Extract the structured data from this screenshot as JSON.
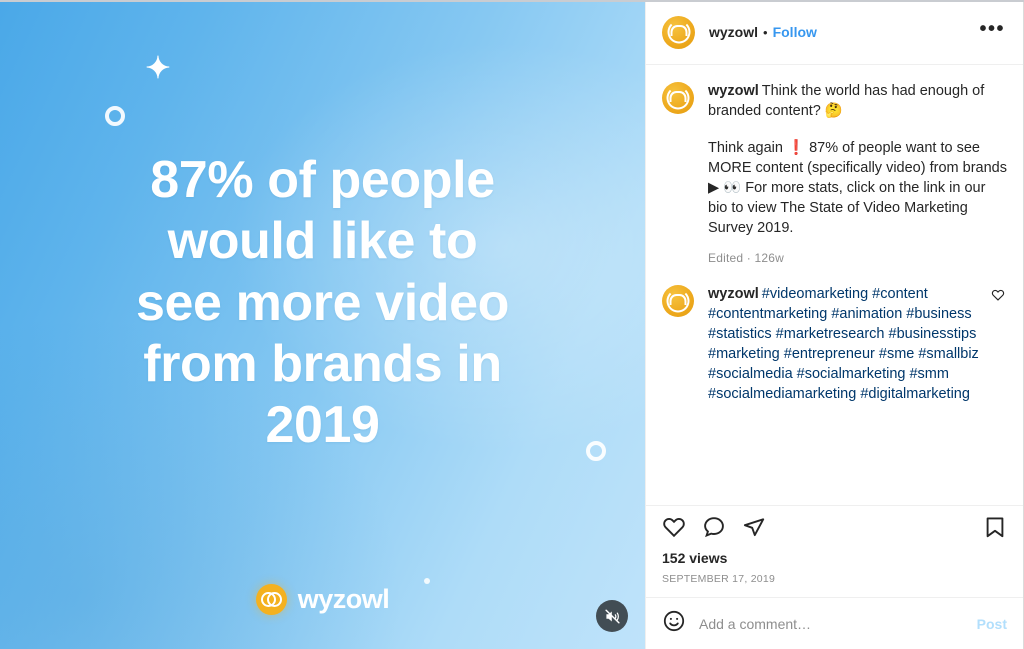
{
  "media": {
    "headline": "87% of people\nwould like to\nsee more video\nfrom brands in\n2019",
    "brand_name": "wyzowl",
    "brand_color": "#f4b11f",
    "bg_color_start": "#4aa8e8",
    "bg_color_end": "#bfe3fa",
    "sparkle_glyph": "✦",
    "mute_icon": "speaker-muted-icon"
  },
  "header": {
    "username": "wyzowl",
    "separator": "•",
    "follow_label": "Follow",
    "more_label": "•••",
    "avatar_icon": "wyzowl-avatar"
  },
  "caption": {
    "username": "wyzowl",
    "line1": "Think the world has had enough of branded content? 🤔",
    "line2": "Think again ❗ 87% of people want to see MORE content (specifically video) from brands ▶ 👀 For more stats, click on the link in our bio to view The State of Video Marketing Survey 2019.",
    "edited_label": "Edited",
    "edited_separator": "·",
    "age": "126w"
  },
  "comment": {
    "username": "wyzowl",
    "hashtags": "#videomarketing #content #contentmarketing #animation #business #statistics #marketresearch #businesstips #marketing #entrepreneur #sme #smallbiz #socialmedia #socialmarketing #smm #socialmediamarketing #digitalmarketing",
    "like_icon": "heart-icon"
  },
  "actions": {
    "like_icon": "heart-icon",
    "comment_icon": "speech-bubble-icon",
    "share_icon": "paper-plane-icon",
    "save_icon": "bookmark-icon",
    "views": "152 views",
    "date": "SEPTEMBER 17, 2019"
  },
  "composer": {
    "emoji_icon": "smiley-face-icon",
    "placeholder": "Add a comment…",
    "value": "",
    "post_label": "Post",
    "post_color": "#b2dffc"
  }
}
